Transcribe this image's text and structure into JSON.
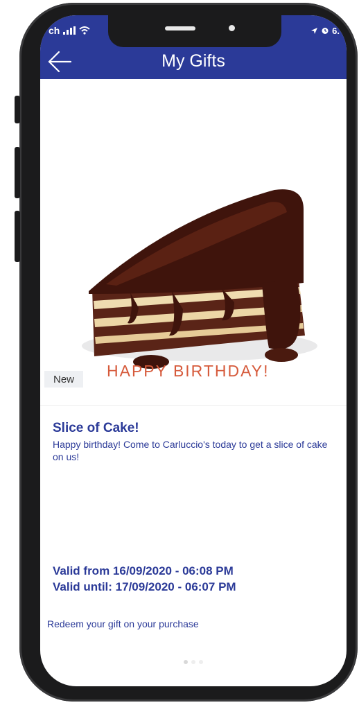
{
  "status_bar": {
    "carrier": "ch"
  },
  "header": {
    "title": "My Gifts"
  },
  "gift": {
    "badge": "New",
    "image_caption": "HAPPY BIRTHDAY!",
    "title": "Slice of Cake!",
    "description": "Happy birthday! Come to Carluccio's today to get a slice of cake on us!",
    "valid_from": "Valid from 16/09/2020 - 06:08 PM",
    "valid_until": "Valid until: 17/09/2020 - 06:07 PM",
    "redeem_note": "Redeem your gift on your purchase"
  },
  "pagination": {
    "pages": 3,
    "active_page": 1
  },
  "icons": [
    "back-arrow-icon",
    "signal-icon",
    "wifi-icon",
    "location-icon",
    "alarm-icon"
  ],
  "colors": {
    "brand": "#2b3a98",
    "caption": "#d65a3b",
    "frame": "#1b1b1c"
  }
}
